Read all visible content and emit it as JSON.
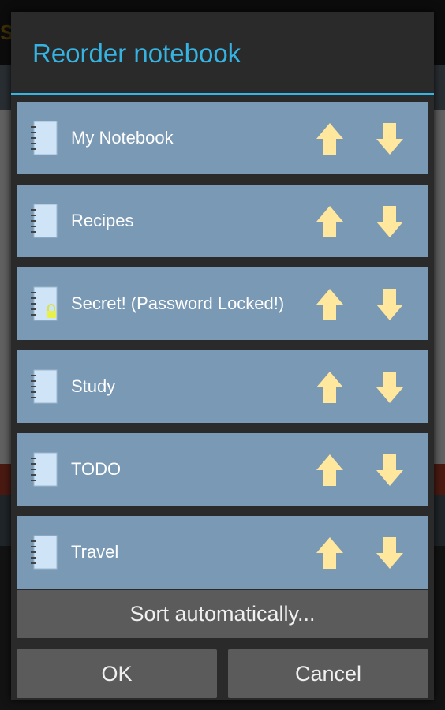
{
  "dialog": {
    "title": "Reorder notebook",
    "accent_color": "#33b5e5",
    "row_color": "#7a99b5",
    "arrow_color": "#ffe79e"
  },
  "notebooks": [
    {
      "label": "My Notebook",
      "icon": "notebook-icon",
      "locked": false
    },
    {
      "label": "Recipes",
      "icon": "notebook-icon",
      "locked": false
    },
    {
      "label": "Secret! (Password Locked!)",
      "icon": "locked-notebook-icon",
      "locked": true
    },
    {
      "label": "Study",
      "icon": "notebook-icon",
      "locked": false
    },
    {
      "label": "TODO",
      "icon": "notebook-icon",
      "locked": false
    },
    {
      "label": "Travel",
      "icon": "notebook-icon",
      "locked": false
    }
  ],
  "buttons": {
    "sort": "Sort automatically...",
    "ok": "OK",
    "cancel": "Cancel"
  }
}
